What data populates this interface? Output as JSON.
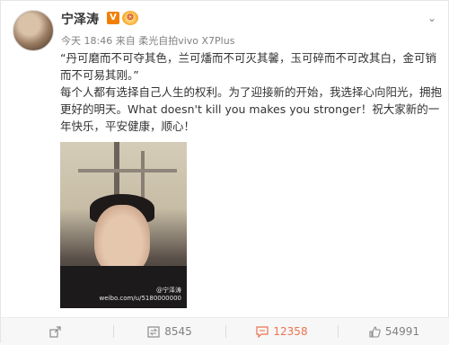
{
  "post": {
    "author": "宁泽涛",
    "vip_badge": "V",
    "level_badge": "❂",
    "time": "今天 18:46",
    "source_prefix": "来自",
    "source": "柔光自拍vivo X7Plus",
    "paragraph1": "“丹可磨而不可夺其色，兰可燔而不可灭其馨，玉可碎而不可改其白，金可销而不可易其刚。”",
    "paragraph2": "每个人都有选择自己人生的权利。为了迎接新的开始，我选择心向阳光，拥抱更好的明天。What doesn't kill you makes you stronger！祝大家新的一年快乐，平安健康，顺心！",
    "watermark_line1": "@宁泽涛",
    "watermark_line2": "weibo.com/u/5180000000"
  },
  "actions": {
    "share_count": "",
    "repost_count": "8545",
    "comment_count": "12358",
    "like_count": "54991"
  },
  "colors": {
    "accent": "#eb7350",
    "vip": "#f27f00",
    "muted": "#808080"
  },
  "icons": [
    "chevron-down-icon",
    "share-icon",
    "repost-icon",
    "comment-icon",
    "like-icon"
  ]
}
